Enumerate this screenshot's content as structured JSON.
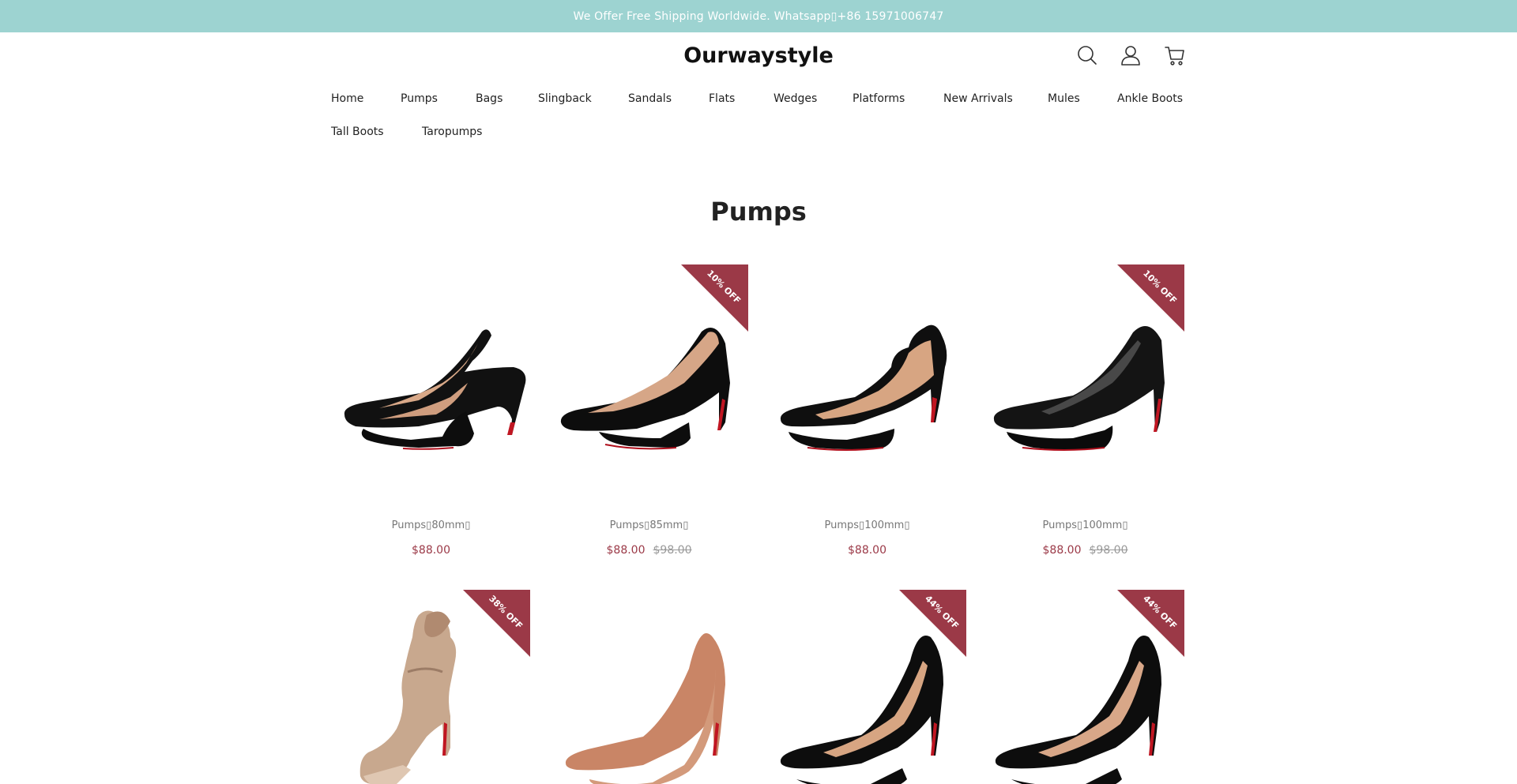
{
  "announcement": "We Offer Free Shipping Worldwide. Whatsapp▯+86 15971006747",
  "logo": "Ourwaystyle",
  "icons": [
    "search-icon",
    "account-icon",
    "cart-icon"
  ],
  "nav": [
    "Home",
    "Pumps",
    "Bags",
    "Slingback",
    "Sandals",
    "Flats",
    "Wedges",
    "Platforms",
    "New Arrivals",
    "Mules",
    "Ankle Boots",
    "Tall Boots",
    "Taropumps"
  ],
  "page_title": "Pumps",
  "colors": {
    "announcement_bg": "#9dd3d1",
    "accent": "#9b3947"
  },
  "products": [
    {
      "name": "Pumps▯80mm▯",
      "price": "$88.00",
      "compare_price": "",
      "badge": ""
    },
    {
      "name": "Pumps▯85mm▯",
      "price": "$88.00",
      "compare_price": "$98.00",
      "badge": "10% OFF"
    },
    {
      "name": "Pumps▯100mm▯",
      "price": "$88.00",
      "compare_price": "",
      "badge": ""
    },
    {
      "name": "Pumps▯100mm▯",
      "price": "$88.00",
      "compare_price": "$98.00",
      "badge": "10% OFF"
    },
    {
      "name": "",
      "price": "",
      "compare_price": "",
      "badge": "38% OFF"
    },
    {
      "name": "",
      "price": "",
      "compare_price": "",
      "badge": ""
    },
    {
      "name": "",
      "price": "",
      "compare_price": "",
      "badge": "44% OFF"
    },
    {
      "name": "",
      "price": "",
      "compare_price": "",
      "badge": "44% OFF"
    }
  ]
}
